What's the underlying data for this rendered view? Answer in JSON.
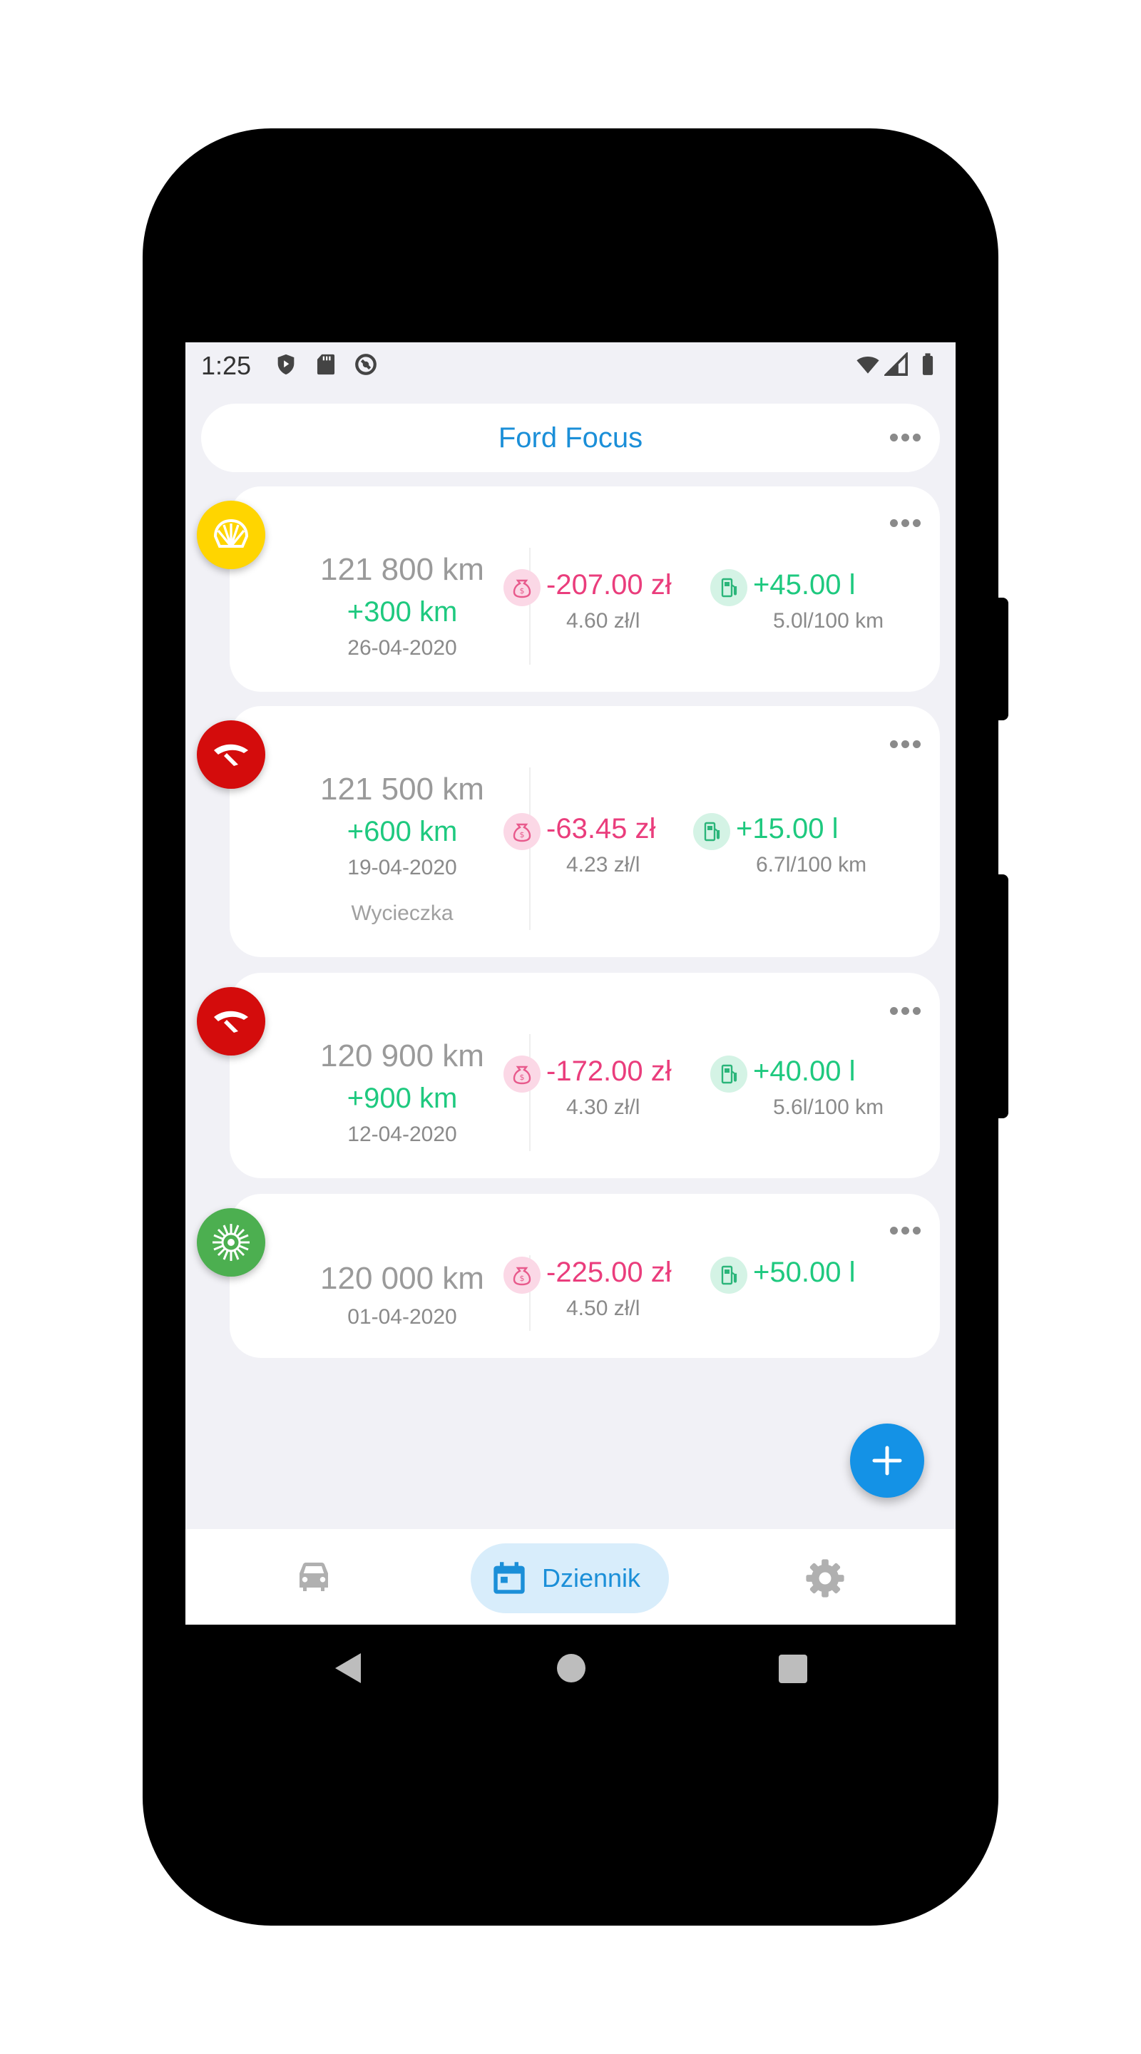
{
  "status_bar": {
    "time": "1:25"
  },
  "header": {
    "title": "Ford Focus"
  },
  "entries": [
    {
      "brand": "shell-icon",
      "brand_color": "#ffd500",
      "odometer": "121 800 km",
      "distance": "+300 km",
      "date": "26-04-2020",
      "note": "",
      "cost": "-207.00 zł",
      "unit_price": "4.60 zł/l",
      "fuel": "+45.00 l",
      "consumption": "5.0l/100 km"
    },
    {
      "brand": "orlen-eagle-icon",
      "brand_color": "#d40c0c",
      "odometer": "121 500 km",
      "distance": "+600 km",
      "date": "19-04-2020",
      "note": "Wycieczka",
      "cost": "-63.45 zł",
      "unit_price": "4.23 zł/l",
      "fuel": "+15.00 l",
      "consumption": "6.7l/100 km"
    },
    {
      "brand": "orlen-eagle-icon",
      "brand_color": "#d40c0c",
      "odometer": "120 900 km",
      "distance": "+900 km",
      "date": "12-04-2020",
      "note": "",
      "cost": "-172.00 zł",
      "unit_price": "4.30 zł/l",
      "fuel": "+40.00 l",
      "consumption": "5.6l/100 km"
    },
    {
      "brand": "bp-helios-icon",
      "brand_color": "#4caf50",
      "odometer": "120 000 km",
      "distance": "",
      "date": "01-04-2020",
      "note": "",
      "cost": "-225.00 zł",
      "unit_price": "4.50 zł/l",
      "fuel": "+50.00 l",
      "consumption": ""
    }
  ],
  "bottom_nav": {
    "items": [
      {
        "icon": "car-icon",
        "label": ""
      },
      {
        "icon": "calendar-icon",
        "label": "Dziennik",
        "active": true
      },
      {
        "icon": "gear-icon",
        "label": ""
      }
    ]
  },
  "colors": {
    "accent": "#1b8fd8",
    "cost": "#ea3d7c",
    "fuel": "#1ec97f",
    "fab": "#1492e6"
  }
}
